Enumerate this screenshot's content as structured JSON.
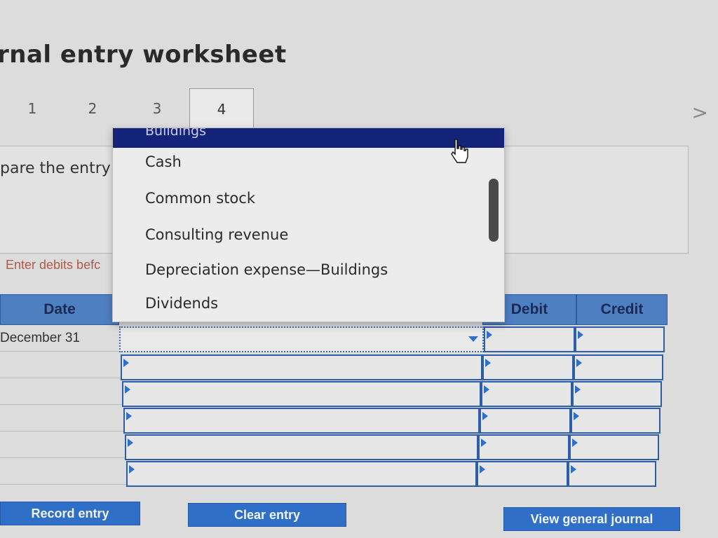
{
  "header": {
    "title": "rnal entry worksheet"
  },
  "tabs": [
    {
      "label": "1"
    },
    {
      "label": "2"
    },
    {
      "label": "3"
    },
    {
      "label": "4"
    }
  ],
  "nav": {
    "next_icon": "chevron-right-icon",
    "next_glyph": ">"
  },
  "instruction": {
    "text": "pare the entry"
  },
  "note": {
    "text": "Enter debits befc"
  },
  "journal": {
    "columns": {
      "date": "Date",
      "debit": "Debit",
      "credit": "Credit"
    },
    "first_row_date": "December 31"
  },
  "account_dropdown": {
    "highlighted": "Buildings",
    "options": [
      "Cash",
      "Common stock",
      "Consulting revenue",
      "Depreciation expense—Buildings",
      "Dividends"
    ]
  },
  "buttons": {
    "record": "Record entry",
    "clear": "Clear entry",
    "view": "View general journal"
  },
  "colors": {
    "accent": "#2f6fc7",
    "header": "#4d7fc1",
    "highlight": "#13237a"
  }
}
